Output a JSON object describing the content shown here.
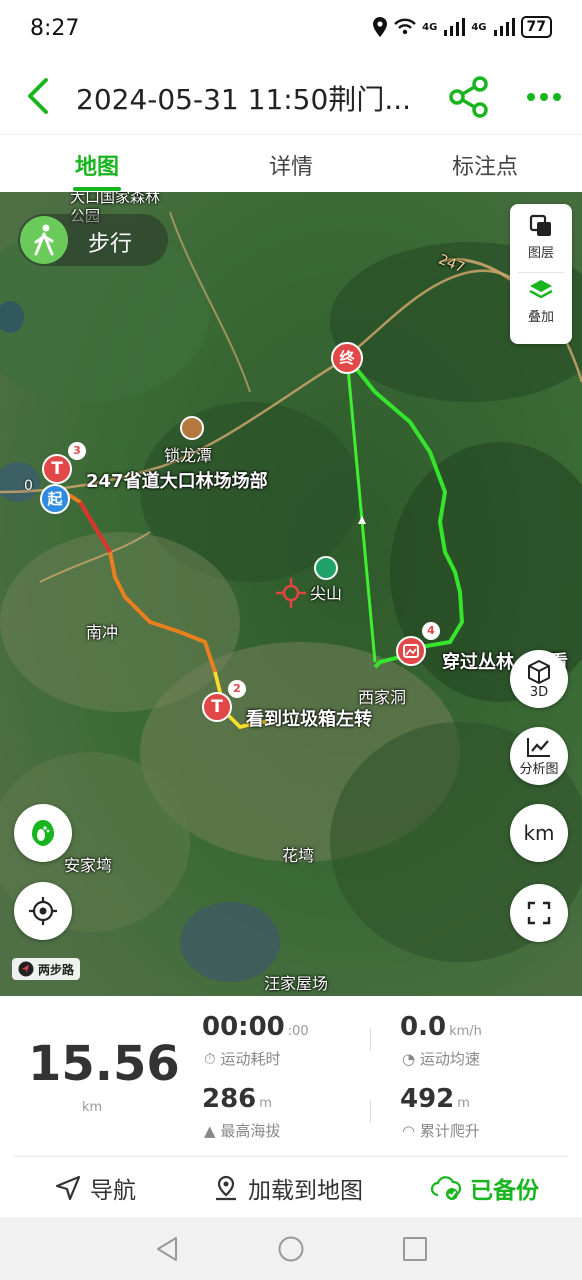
{
  "status_bar": {
    "time": "8:27",
    "network": "4G",
    "battery": "77"
  },
  "header": {
    "title": "2024-05-31 11:50荆门..."
  },
  "tabs": [
    {
      "label": "地图",
      "active": true
    },
    {
      "label": "详情",
      "active": false
    },
    {
      "label": "标注点",
      "active": false
    }
  ],
  "map": {
    "mode_label": "步行",
    "layers_label": "图层",
    "overlay_label": "叠加",
    "btn_3d": "3D",
    "btn_analysis": "分析图",
    "btn_unit": "km",
    "scale_label": "两步路",
    "start_marker": "起",
    "end_marker": "终",
    "markers": [
      {
        "number": "0",
        "label": ""
      },
      {
        "number": "3",
        "label": "247省道大口林场场部"
      },
      {
        "number": "2",
        "label": "看到垃圾箱左转"
      },
      {
        "number": "4",
        "label": "穿过丛林，去看"
      }
    ],
    "place_labels": {
      "forest_park": "大口国家森林公园",
      "road_number": "247",
      "suolongtan": "锁龙潭",
      "jianshan": "尖山",
      "nanchong": "南冲",
      "xidong": "西家洞",
      "anjiawan": "安家塆",
      "huawan": "花塆",
      "wangjiawu": "汪家屋场"
    },
    "colors": {
      "track_green": "#35e52c",
      "track_orange": "#e8801e",
      "track_red": "#d9342b",
      "brand_green": "#19b51f"
    }
  },
  "stats": {
    "distance": "15.56",
    "distance_unit": "km",
    "duration": "00:00",
    "duration_seconds": ":00",
    "duration_label": "运动耗时",
    "avg_speed": "0.0",
    "avg_speed_unit": "km/h",
    "avg_speed_label": "运动均速",
    "max_altitude": "286",
    "max_altitude_unit": "m",
    "max_altitude_label": "最高海拔",
    "total_climb": "492",
    "total_climb_unit": "m",
    "total_climb_label": "累计爬升"
  },
  "actions": {
    "navigate": "导航",
    "load_to_map": "加载到地图",
    "backed_up": "已备份"
  }
}
